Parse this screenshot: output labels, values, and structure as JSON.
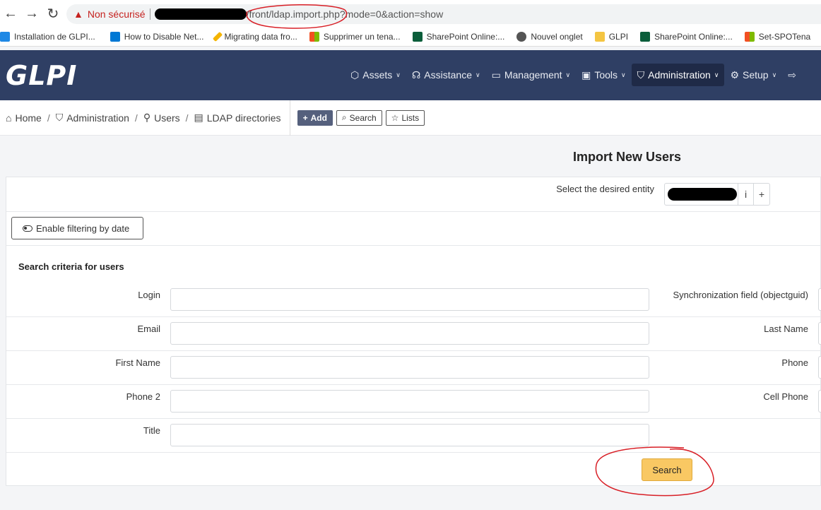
{
  "browser": {
    "security_label": "Non sécurisé",
    "url_path": "/front/ldap.import.php",
    "url_query": "?mode=0&action=show",
    "bookmarks": [
      {
        "label": "Installation de GLPI...",
        "icon": "layers-icon",
        "color": "#1e88e5"
      },
      {
        "label": "How to Disable Net...",
        "icon": "windows-icon",
        "color": "#0078d4"
      },
      {
        "label": "Migrating data fro...",
        "icon": "pencil-icon",
        "color": "#f4b400"
      },
      {
        "label": "Supprimer un tena...",
        "icon": "microsoft-icon",
        "color": "#f25022"
      },
      {
        "label": "SharePoint Online:...",
        "icon": "ps-icon",
        "color": "#0b5e3b"
      },
      {
        "label": "Nouvel onglet",
        "icon": "globe-icon",
        "color": "#555555"
      },
      {
        "label": "GLPI",
        "icon": "folder-icon",
        "color": "#f4c542"
      },
      {
        "label": "SharePoint Online:...",
        "icon": "ps-icon",
        "color": "#0b5e3b"
      },
      {
        "label": "Set-SPOTena",
        "icon": "microsoft-icon",
        "color": "#f25022"
      }
    ]
  },
  "header": {
    "logo": "GLPI",
    "menu": [
      {
        "label": "Assets",
        "icon": "cube-icon"
      },
      {
        "label": "Assistance",
        "icon": "headset-icon"
      },
      {
        "label": "Management",
        "icon": "wallet-icon"
      },
      {
        "label": "Tools",
        "icon": "briefcase-icon"
      },
      {
        "label": "Administration",
        "icon": "shield-icon",
        "active": true
      },
      {
        "label": "Setup",
        "icon": "gear-icon"
      }
    ],
    "accent": "#2f3f64"
  },
  "breadcrumb": {
    "home": "Home",
    "administration": "Administration",
    "users": "Users",
    "ldap": "LDAP directories"
  },
  "actions": {
    "add": "Add",
    "search": "Search",
    "lists": "Lists"
  },
  "page": {
    "title": "Import New Users",
    "entity_label": "Select the desired entity",
    "entity_info": "i",
    "entity_add": "+",
    "filter_button": "Enable filtering by date",
    "criteria_title": "Search criteria for users",
    "fields_left": [
      {
        "label": "Login",
        "value": ""
      },
      {
        "label": "Email",
        "value": ""
      },
      {
        "label": "First Name",
        "value": ""
      },
      {
        "label": "Phone 2",
        "value": ""
      },
      {
        "label": "Title",
        "value": ""
      }
    ],
    "fields_right": [
      {
        "label": "Synchronization field (objectguid)",
        "value": ""
      },
      {
        "label": "Last Name",
        "value": ""
      },
      {
        "label": "Phone",
        "value": ""
      },
      {
        "label": "Cell Phone",
        "value": ""
      }
    ],
    "search_button": "Search",
    "search_button_color": "#f9c863"
  }
}
